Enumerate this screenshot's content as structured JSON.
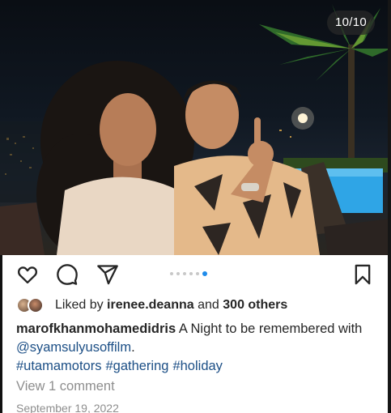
{
  "post": {
    "image_counter": "10/10",
    "carousel": {
      "total_dots": 6,
      "active_index": 5
    },
    "likes": {
      "prefix": "Liked by",
      "first_user": "irenee.deanna",
      "connector": "and",
      "others": "300 others"
    },
    "caption": {
      "username": "marofkhanmohamedidris",
      "text": "A Night to be remembered with",
      "mention": "@syamsulyusoffilm",
      "after_mention": ".",
      "hashtags": [
        "#utamamotors",
        "#gathering",
        "#holiday"
      ]
    },
    "comments_link": "View 1 comment",
    "date": "September 19, 2022"
  },
  "icons": {
    "like": "heart-icon",
    "comment": "comment-bubble-icon",
    "share": "paper-plane-icon",
    "save": "bookmark-icon"
  },
  "colors": {
    "link": "#1c4f86",
    "active_dot": "#1f8ceb",
    "muted_text": "#8e8e8e"
  }
}
